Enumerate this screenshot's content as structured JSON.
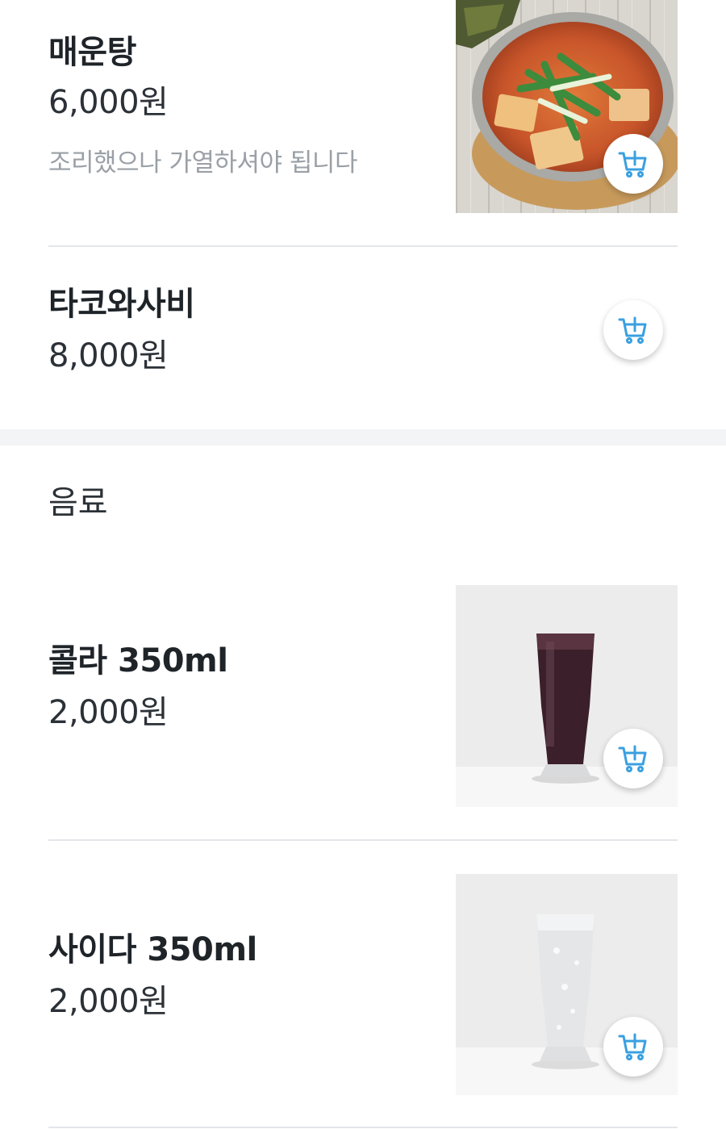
{
  "colors": {
    "accent": "#3aa0e0",
    "divider": "#e3e6ea",
    "section_gap": "#f2f4f6",
    "muted_text": "#9aa0a6"
  },
  "menu_items": [
    {
      "name": "매운탕",
      "price": "6,000원",
      "description": "조리했으나 가열하셔야 됩니다",
      "image": "spicy-fish-stew-photo",
      "cart_icon": "cart-add-icon"
    },
    {
      "name": "타코와사비",
      "price": "8,000원",
      "cart_icon": "cart-add-icon"
    }
  ],
  "drinks_section": {
    "title": "음료",
    "items": [
      {
        "name": "콜라 350ml",
        "price": "2,000원",
        "image": "cola-glass-photo",
        "cart_icon": "cart-add-icon"
      },
      {
        "name": "사이다 350ml",
        "price": "2,000원",
        "image": "cider-glass-photo",
        "cart_icon": "cart-add-icon"
      }
    ]
  }
}
